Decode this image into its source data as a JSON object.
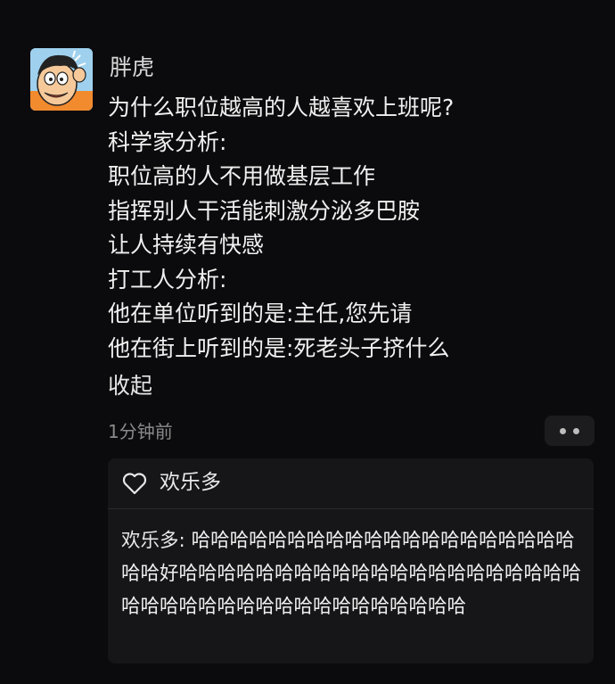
{
  "post": {
    "avatar_icon": "cartoon-boy-avatar-icon",
    "username": "胖虎",
    "lines": [
      "为什么职位越高的人越喜欢上班呢?",
      "科学家分析:",
      "职位高的人不用做基层工作",
      "指挥别人干活能刺激分泌多巴胺",
      "让人持续有快感",
      "打工人分析:",
      "他在单位听到的是:主任,您先请",
      "他在街上听到的是:死老头子挤什么"
    ],
    "collapse_label": "收起",
    "timestamp": "1分钟前",
    "more_icon": "more-dots-icon"
  },
  "interactions": {
    "like_icon": "heart-icon",
    "liked_by": "欢乐多"
  },
  "comment": {
    "author": "欢乐多:",
    "text": " 哈哈哈哈哈哈哈哈哈哈哈哈哈哈哈哈哈哈哈哈哈哈好哈哈哈哈哈哈哈哈哈哈哈哈哈哈哈哈哈哈哈哈哈哈哈哈哈哈哈哈哈哈哈哈哈哈哈哈哈哈哈"
  },
  "colors": {
    "background": "#0b0b0d",
    "reply_panel": "#161618",
    "text": "#f0f0f0",
    "muted": "#8a8a8a"
  }
}
